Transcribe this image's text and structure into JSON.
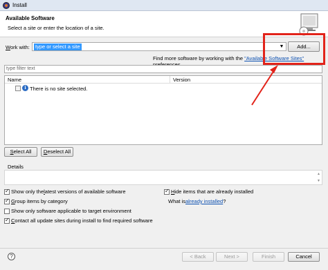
{
  "window": {
    "title": "Install"
  },
  "banner": {
    "title": "Available Software",
    "subtitle": "Select a site or enter the location of a site."
  },
  "work_with": {
    "label_mnemonic": "W",
    "label_rest": "ork with:",
    "value": "type or select a site",
    "add_label": "Add..."
  },
  "find_more": {
    "prefix": "Find more software by working with the ",
    "link": "\"Available Software Sites\"",
    "suffix": " preferences."
  },
  "filter": {
    "placeholder": "type filter text"
  },
  "table": {
    "columns": [
      "Name",
      "Version"
    ],
    "rows": [
      {
        "name": "There is no site selected.",
        "version": ""
      }
    ]
  },
  "selection_buttons": {
    "select_all_mnemonic": "S",
    "select_all_rest": "elect All",
    "deselect_all_mnemonic": "D",
    "deselect_all_rest": "eselect All"
  },
  "details": {
    "label": "Details"
  },
  "options": {
    "latest_prefix": "Show only the ",
    "latest_mn": "l",
    "latest_rest": "atest versions of available software",
    "latest_checked": true,
    "group_mn": "G",
    "group_rest": "roup items by category",
    "group_checked": true,
    "applicable_label": "Show only software applicable to target environment",
    "applicable_checked": false,
    "contact_mn": "C",
    "contact_rest": "ontact all update sites during install to find required software",
    "contact_checked": true,
    "hide_mn": "H",
    "hide_rest": "ide items that are already installed",
    "hide_checked": true,
    "whatis_prefix": "What is ",
    "whatis_link": "already installed",
    "whatis_suffix": "?"
  },
  "footer": {
    "back_label": "< Back",
    "next_label": "Next >",
    "finish_label": "Finish",
    "cancel_label": "Cancel"
  },
  "colors": {
    "callout": "#e2231a",
    "selection": "#3399ff",
    "link": "#0b4fb0"
  }
}
